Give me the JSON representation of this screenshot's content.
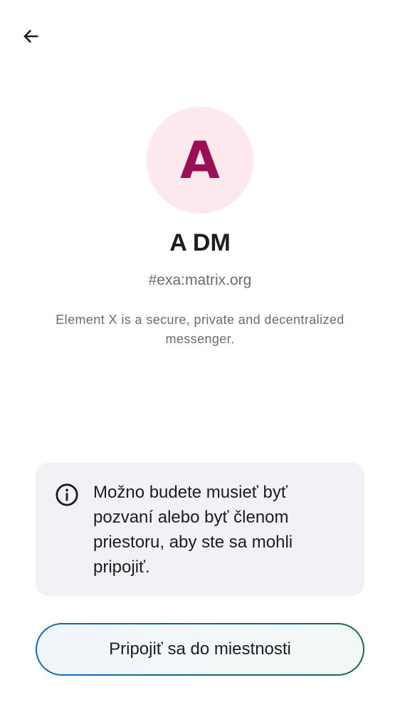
{
  "header": {
    "back_icon": "arrow-left-icon"
  },
  "room": {
    "avatar_letter": "A",
    "avatar_bg_color": "#fde8ee",
    "avatar_text_color": "#9b0f55",
    "name": "A DM",
    "alias": "#exa:matrix.org",
    "topic": "Element X is a secure, private and decentralized messenger."
  },
  "notice": {
    "icon": "info-icon",
    "text": "Možno budete musieť byť pozvaní alebo byť členom priestoru, aby ste sa mohli pripojiť."
  },
  "join_button": {
    "label": "Pripojiť sa do miestnosti"
  }
}
